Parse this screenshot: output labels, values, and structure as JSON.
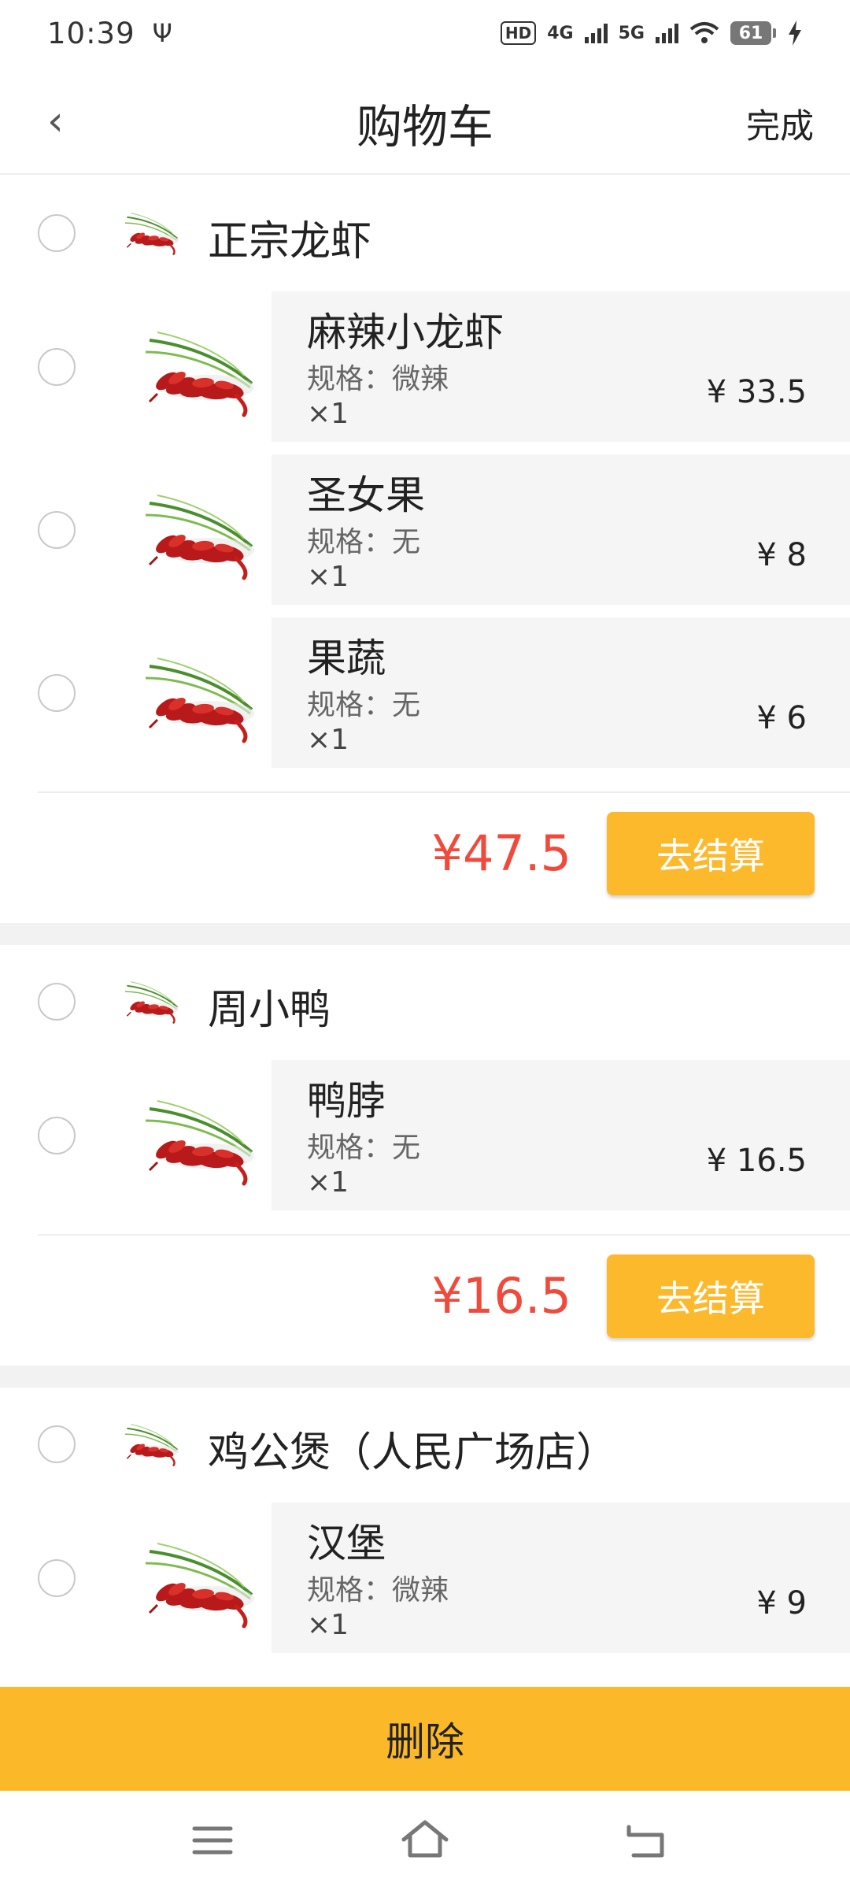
{
  "status_bar": {
    "time": "10:39",
    "usb_symbol": "Ψ",
    "hd_label": "HD",
    "net1": "4G",
    "net2": "5G",
    "battery": "61"
  },
  "header": {
    "back_symbol": "‹",
    "title": "购物车",
    "done": "完成"
  },
  "shops": [
    {
      "name": "正宗龙虾",
      "items": [
        {
          "name": "麻辣小龙虾",
          "spec": "规格：微辣",
          "qty": "×1",
          "price": "¥ 33.5"
        },
        {
          "name": "圣女果",
          "spec": "规格：无",
          "qty": "×1",
          "price": "¥ 8"
        },
        {
          "name": "果蔬",
          "spec": "规格：无",
          "qty": "×1",
          "price": "¥ 6"
        }
      ],
      "total": "¥47.5",
      "checkout": "去结算"
    },
    {
      "name": "周小鸭",
      "items": [
        {
          "name": "鸭脖",
          "spec": "规格：无",
          "qty": "×1",
          "price": "¥ 16.5"
        }
      ],
      "total": "¥16.5",
      "checkout": "去结算"
    },
    {
      "name": "鸡公煲（人民广场店）",
      "items": [
        {
          "name": "汉堡",
          "spec": "规格：微辣",
          "qty": "×1",
          "price": "¥ 9"
        }
      ]
    }
  ],
  "delete_button": "删除",
  "colors": {
    "accent": "#fbb929",
    "price_red": "#f04a3d",
    "card_bg": "#f5f5f5"
  },
  "icons": [
    "back-icon",
    "crayfish-image",
    "menu-icon",
    "home-icon",
    "back-nav-icon"
  ]
}
